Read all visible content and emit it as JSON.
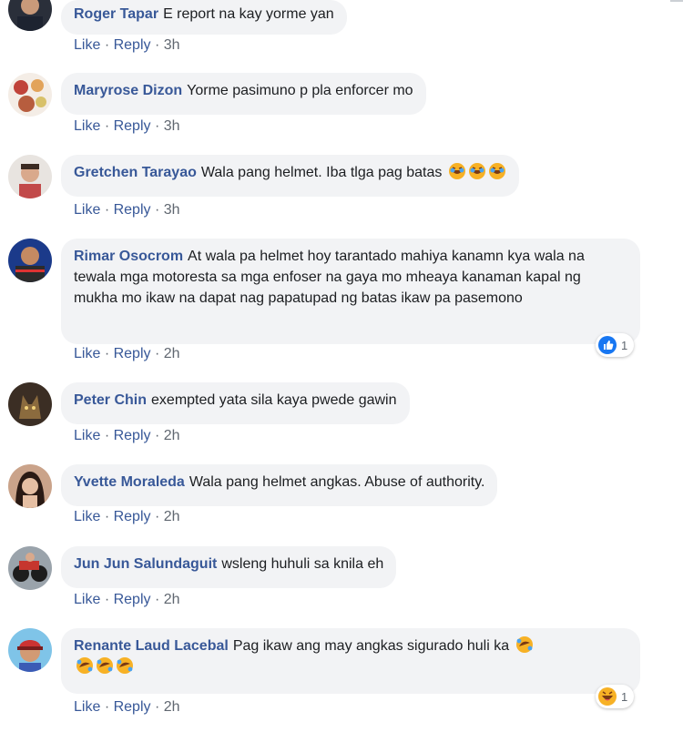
{
  "actions": {
    "like_label": "Like",
    "reply_label": "Reply",
    "separator": "·"
  },
  "comments": [
    {
      "author": "Roger Tapar",
      "text": "E report na kay yorme yan",
      "time": "3h",
      "emojis": []
    },
    {
      "author": "Maryrose Dizon",
      "text": "Yorme pasimuno p pla enforcer mo",
      "time": "3h",
      "emojis": []
    },
    {
      "author": "Gretchen Tarayao",
      "text": "Wala pang helmet. Iba tlga pag batas",
      "time": "3h",
      "emojis": [
        "laughing-emoji",
        "laughing-emoji",
        "laughing-emoji"
      ]
    },
    {
      "author": "Rimar Osocrom",
      "text": "At wala pa helmet hoy tarantado mahiya kanamn kya wala na tewala mga motoresta sa mga enfoser na gaya mo mheaya kanaman kapal ng mukha mo ikaw na dapat nag papatupad ng batas ikaw pa pasemono",
      "time": "2h",
      "emojis": [],
      "reaction": {
        "icon": "like-reaction-icon",
        "count": "1"
      }
    },
    {
      "author": "Peter Chin",
      "text": "exempted yata sila kaya pwede gawin",
      "time": "2h",
      "emojis": []
    },
    {
      "author": "Yvette Moraleda",
      "text": "Wala pang helmet angkas. Abuse of authority.",
      "time": "2h",
      "emojis": []
    },
    {
      "author": "Jun Jun Salundaguit",
      "text": "wsleng huhuli sa knila eh",
      "time": "2h",
      "emojis": []
    },
    {
      "author": "Renante Laud Lacebal",
      "text": "Pag ikaw ang may angkas sigurado huli ka",
      "time": "2h",
      "emojis": [
        "rofl-emoji",
        "rofl-emoji",
        "rofl-emoji",
        "rofl-emoji"
      ],
      "reaction": {
        "icon": "haha-reaction-icon",
        "count": "1"
      }
    }
  ]
}
